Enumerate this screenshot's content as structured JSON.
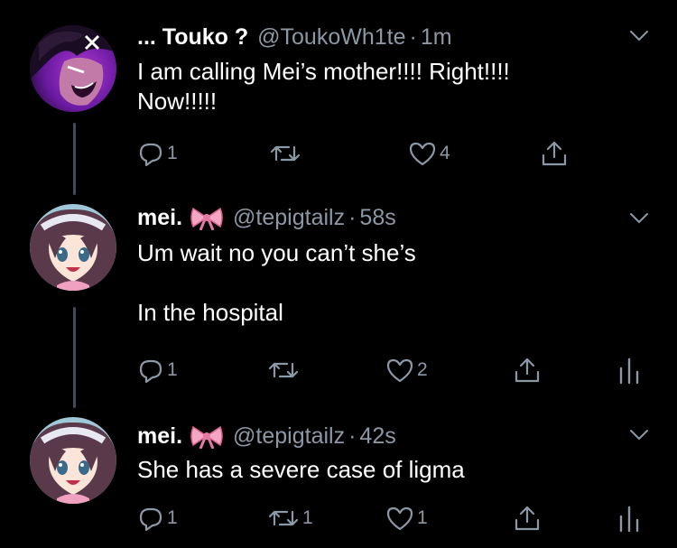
{
  "colors": {
    "background": "#000000",
    "text": "#ffffff",
    "secondary": "#8b98a5",
    "thread_line": "#3d4c5c"
  },
  "tweets": [
    {
      "name": "... Touko ?",
      "handle": "@ToukoWh1te",
      "separator": "·",
      "time": "1m",
      "text": "I am calling Mei’s mother!!!!  Right!!!!\nNow!!!!!",
      "reply_count": "1",
      "retweet_count": "",
      "like_count": "4",
      "avatar": "touko-avatar",
      "name_icon": "",
      "show_analytics": false
    },
    {
      "name": "mei.",
      "handle": "@tepigtailz",
      "separator": "·",
      "time": "58s",
      "text": "Um wait no you can’t she’s\n\nIn the hospital",
      "reply_count": "1",
      "retweet_count": "",
      "like_count": "2",
      "avatar": "mei-avatar",
      "name_icon": "ribbon-bow-icon",
      "show_analytics": true
    },
    {
      "name": "mei.",
      "handle": "@tepigtailz",
      "separator": "·",
      "time": "42s",
      "text": "She has a severe case of ligma",
      "reply_count": "1",
      "retweet_count": "1",
      "like_count": "1",
      "avatar": "mei-avatar",
      "name_icon": "ribbon-bow-icon",
      "show_analytics": true
    }
  ]
}
